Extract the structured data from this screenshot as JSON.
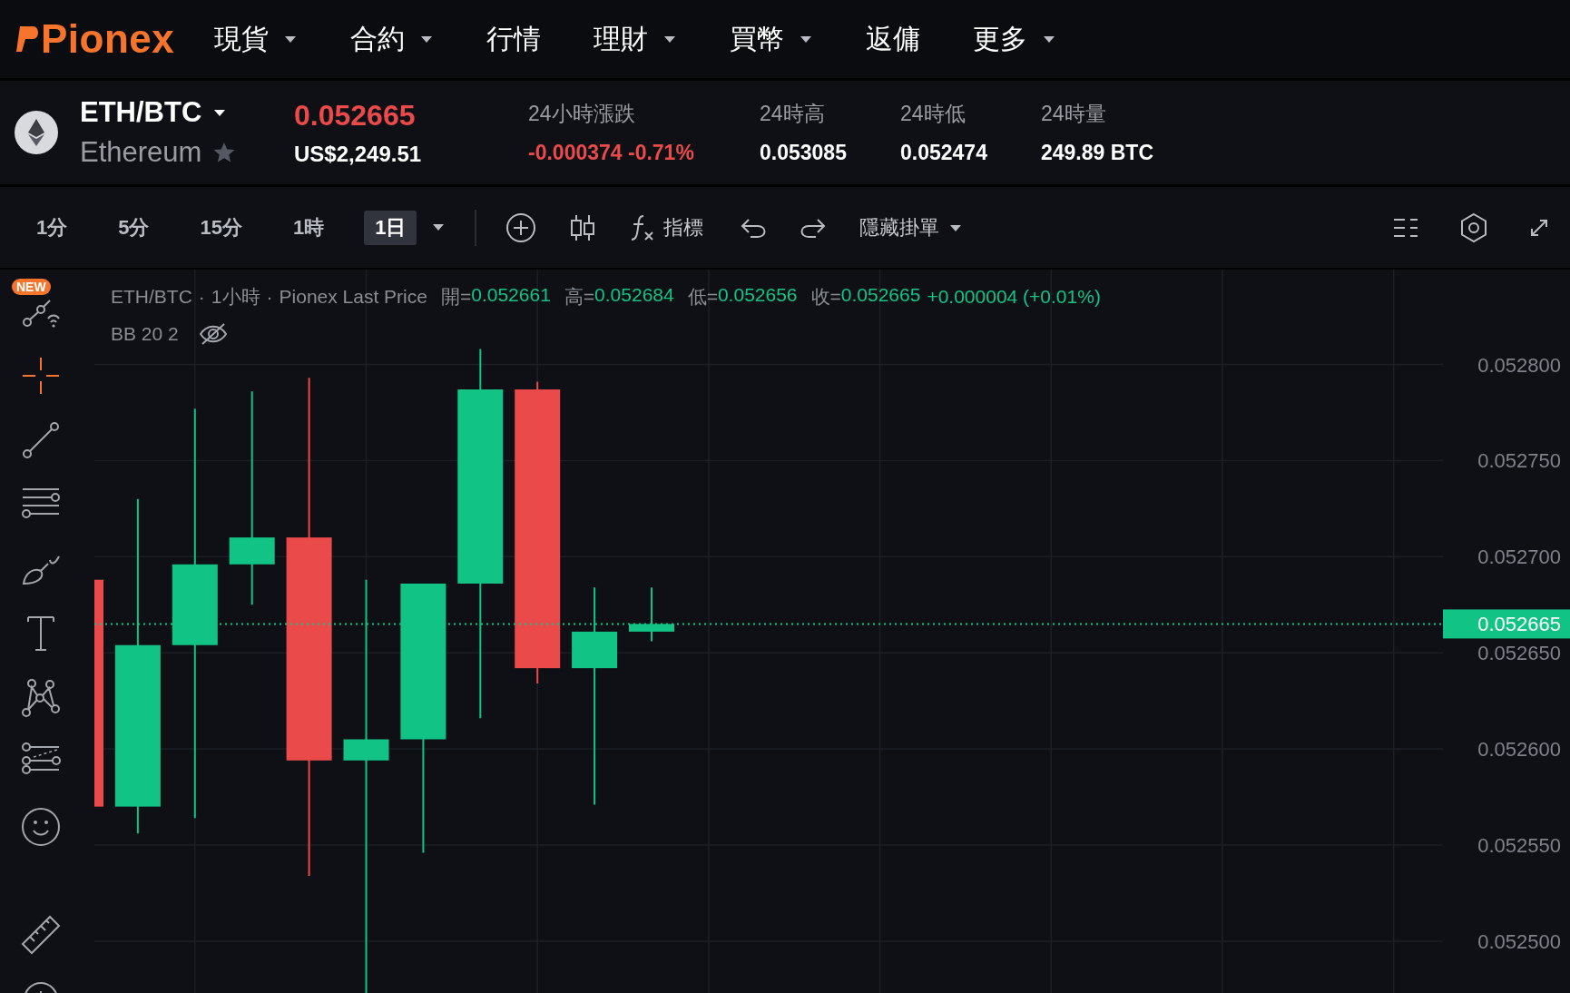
{
  "nav": {
    "logo_text": "Pionex",
    "items": [
      {
        "label": "現貨",
        "has_menu": true
      },
      {
        "label": "合約",
        "has_menu": true
      },
      {
        "label": "行情",
        "has_menu": false
      },
      {
        "label": "理財",
        "has_menu": true
      },
      {
        "label": "買幣",
        "has_menu": true
      },
      {
        "label": "返傭",
        "has_menu": false
      },
      {
        "label": "更多",
        "has_menu": true
      }
    ]
  },
  "ticker": {
    "pair": "ETH/BTC",
    "name": "Ethereum",
    "favorite": false,
    "price": "0.052665",
    "price_usd": "US$2,249.51",
    "stats": [
      {
        "label": "24小時漲跌",
        "value": "-0.000374 -0.71%",
        "color": "#ea4a4a"
      },
      {
        "label": "24時高",
        "value": "0.053085",
        "color": "#ffffff"
      },
      {
        "label": "24時低",
        "value": "0.052474",
        "color": "#ffffff"
      },
      {
        "label": "24時量",
        "value": "249.89 BTC",
        "color": "#ffffff"
      }
    ]
  },
  "toolbar": {
    "intervals": [
      {
        "label": "1分",
        "selected": false
      },
      {
        "label": "5分",
        "selected": false
      },
      {
        "label": "15分",
        "selected": false
      },
      {
        "label": "1時",
        "selected": false
      },
      {
        "label": "1日",
        "selected": true
      }
    ],
    "indicators_label": "指標",
    "orders_label": "隱藏掛單"
  },
  "tools": [
    {
      "kind": "trend-signal",
      "selected": false,
      "badge": "NEW"
    },
    {
      "kind": "crosshair",
      "selected": true
    },
    {
      "kind": "line",
      "selected": false
    },
    {
      "kind": "parallel",
      "selected": false
    },
    {
      "kind": "brush",
      "selected": false
    },
    {
      "kind": "text",
      "selected": false
    },
    {
      "kind": "pattern",
      "selected": false
    },
    {
      "kind": "fib",
      "selected": false
    },
    {
      "kind": "emoji",
      "selected": false
    },
    {
      "kind": "ruler",
      "selected": false
    },
    {
      "kind": "zoom-in",
      "selected": false
    }
  ],
  "chart": {
    "legend": {
      "parts": [
        "ETH/BTC",
        "·",
        "1小時",
        "·",
        "Pionex Last Price"
      ],
      "fields": [
        {
          "label": "開=",
          "value": "0.052661"
        },
        {
          "label": "高=",
          "value": "0.052684"
        },
        {
          "label": "低=",
          "value": "0.052656"
        },
        {
          "label": "收=",
          "value": "0.052665"
        }
      ],
      "change": "+0.000004 (+0.01%)",
      "indicator": "BB 20 2",
      "indicator_hidden": true
    },
    "last_price": "0.052665",
    "price_axis": [
      "0.052800",
      "0.052750",
      "0.052700",
      "0.052650",
      "0.052600",
      "0.052550",
      "0.052500"
    ]
  }
}
